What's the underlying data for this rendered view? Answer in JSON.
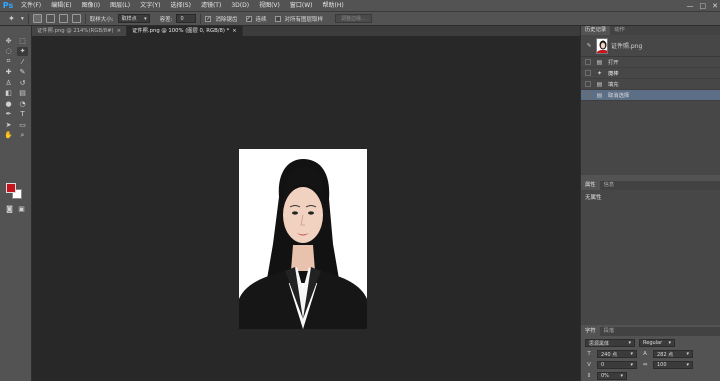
{
  "app": {
    "logo": "Ps"
  },
  "menu": [
    "文件(F)",
    "编辑(E)",
    "图像(I)",
    "图层(L)",
    "文字(Y)",
    "选择(S)",
    "滤镜(T)",
    "3D(D)",
    "视图(V)",
    "窗口(W)",
    "帮助(H)"
  ],
  "window_controls": [
    "—",
    "□",
    "✕"
  ],
  "options": {
    "sample_size_label": "取样大小:",
    "sample_size_value": "取样点",
    "tolerance_label": "容差:",
    "tolerance_value": "0",
    "antialias_label": "消除锯齿",
    "contiguous_label": "连续",
    "all_layers_label": "对所有图层取样",
    "refine_edge_label": "调整边缘..."
  },
  "tabs": [
    {
      "label": "证件照.png @ 214%(RGB/8#)",
      "close": "×"
    },
    {
      "label": "证件照.png @ 100% (图层 0, RGB/8) *",
      "close": "×"
    }
  ],
  "history": {
    "tab_history": "历史记录",
    "tab_actions": "动作",
    "snapshot_label": "证件照.png",
    "items": [
      "打开",
      "魔棒",
      "填充",
      "取消选择"
    ]
  },
  "properties": {
    "tab_properties": "属性",
    "tab_info": "信息",
    "no_properties": "无属性"
  },
  "character": {
    "tab_character": "字符",
    "tab_paragraph": "段落",
    "font_family": "思源黑体",
    "font_style": "Regular",
    "font_size": "240 点",
    "leading": "282 点",
    "kerning": "0",
    "tracking": "100",
    "scale": "0%"
  },
  "colors": {
    "foreground": "#c8141c",
    "background": "#ffffff",
    "selection": "#5d6e87"
  }
}
